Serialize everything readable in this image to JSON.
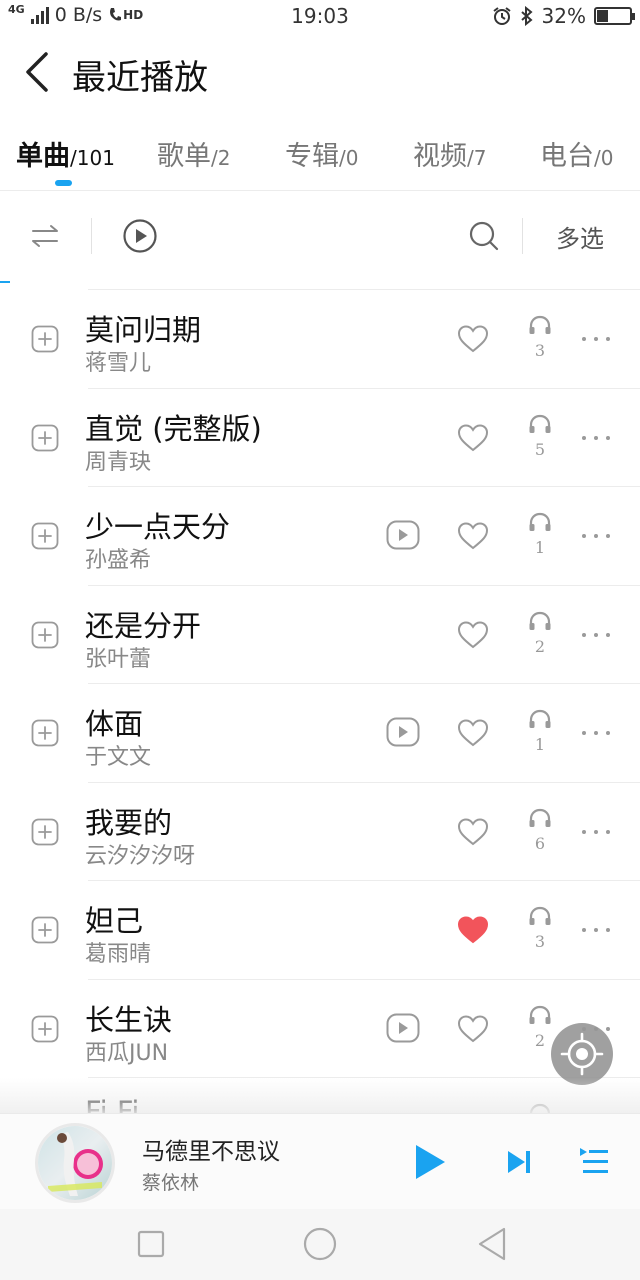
{
  "status_bar": {
    "network_type": "4G",
    "speed": "0 B/s",
    "hd_label": "HD",
    "time": "19:03",
    "battery_percent": "32%",
    "battery_level": 0.32
  },
  "header": {
    "title": "最近播放"
  },
  "tabs": [
    {
      "label": "单曲",
      "count": "/101",
      "active": true
    },
    {
      "label": "歌单",
      "count": "/2",
      "active": false
    },
    {
      "label": "专辑",
      "count": "/0",
      "active": false
    },
    {
      "label": "视频",
      "count": "/7",
      "active": false
    },
    {
      "label": "电台",
      "count": "/0",
      "active": false
    }
  ],
  "toolbar": {
    "multiselect_label": "多选"
  },
  "songs": [
    {
      "title": "莫问归期",
      "artist": "蒋雪儿",
      "has_mv": false,
      "favorited": false,
      "plays": "3"
    },
    {
      "title": "直觉 (完整版)",
      "artist": "周青玦",
      "has_mv": false,
      "favorited": false,
      "plays": "5"
    },
    {
      "title": "少一点天分",
      "artist": "孙盛希",
      "has_mv": true,
      "favorited": false,
      "plays": "1"
    },
    {
      "title": "还是分开",
      "artist": "张叶蕾",
      "has_mv": false,
      "favorited": false,
      "plays": "2"
    },
    {
      "title": "体面",
      "artist": "于文文",
      "has_mv": true,
      "favorited": false,
      "plays": "1"
    },
    {
      "title": "我要的",
      "artist": "云汐汐汐呀",
      "has_mv": false,
      "favorited": false,
      "plays": "6"
    },
    {
      "title": "妲己",
      "artist": "葛雨晴",
      "has_mv": false,
      "favorited": true,
      "plays": "3"
    },
    {
      "title": "长生诀",
      "artist": "西瓜JUN",
      "has_mv": true,
      "favorited": false,
      "plays": "2"
    },
    {
      "title": "Fi Fi",
      "artist": "",
      "has_mv": false,
      "favorited": false,
      "plays": ""
    }
  ],
  "now_playing": {
    "title": "马德里不思议",
    "artist": "蔡依林"
  },
  "colors": {
    "accent": "#1aa3f0",
    "favorite": "#f2545b",
    "icon_gray": "#9a9a9a"
  }
}
